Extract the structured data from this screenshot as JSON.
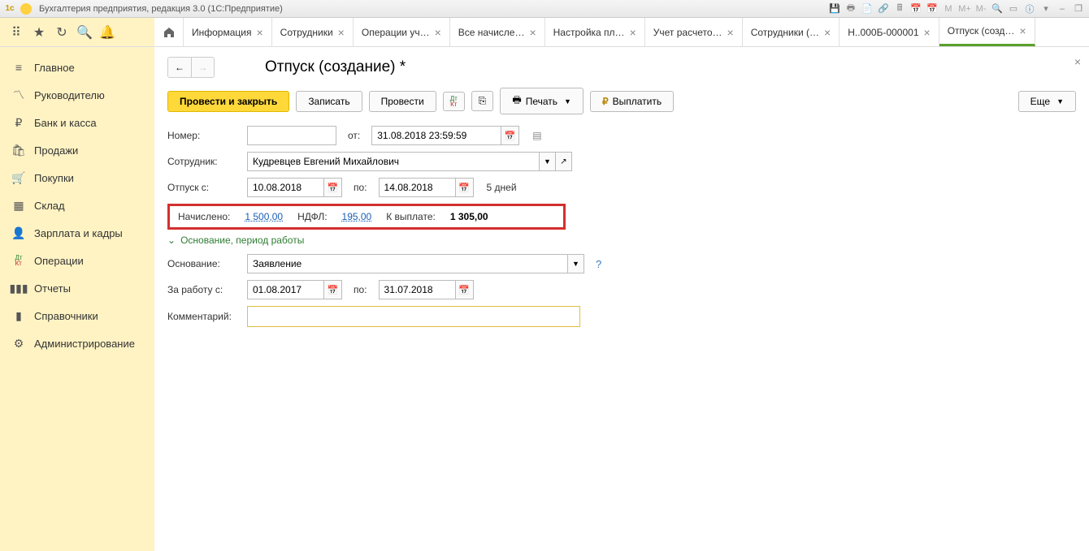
{
  "window": {
    "title": "Бухгалтерия предприятия, редакция 3.0  (1С:Предприятие)"
  },
  "tabs": [
    {
      "label": "Информация"
    },
    {
      "label": "Сотрудники"
    },
    {
      "label": "Операции уч…"
    },
    {
      "label": "Все начисле…"
    },
    {
      "label": "Настройка пл…"
    },
    {
      "label": "Учет расчето…"
    },
    {
      "label": "Сотрудники (…"
    },
    {
      "label": "Н..000Б-000001"
    },
    {
      "label": "Отпуск (созд…",
      "active": true
    }
  ],
  "sidebar": [
    {
      "label": "Главное",
      "icon": "menu"
    },
    {
      "label": "Руководителю",
      "icon": "chart"
    },
    {
      "label": "Банк и касса",
      "icon": "ruble"
    },
    {
      "label": "Продажи",
      "icon": "cart"
    },
    {
      "label": "Покупки",
      "icon": "cart2"
    },
    {
      "label": "Склад",
      "icon": "boxes"
    },
    {
      "label": "Зарплата и кадры",
      "icon": "person"
    },
    {
      "label": "Операции",
      "icon": "dtkt"
    },
    {
      "label": "Отчеты",
      "icon": "bars"
    },
    {
      "label": "Справочники",
      "icon": "book"
    },
    {
      "label": "Администрирование",
      "icon": "gear"
    }
  ],
  "page": {
    "title": "Отпуск (создание) *"
  },
  "buttons": {
    "postClose": "Провести и закрыть",
    "save": "Записать",
    "post": "Провести",
    "print": "Печать",
    "pay": "Выплатить",
    "more": "Еще"
  },
  "form": {
    "numberLabel": "Номер:",
    "number": "",
    "fromLabel": "от:",
    "fromDate": "31.08.2018 23:59:59",
    "employeeLabel": "Сотрудник:",
    "employee": "Кудревцев Евгений Михайлович",
    "vacFromLabel": "Отпуск с:",
    "vacFrom": "10.08.2018",
    "toLabel": "по:",
    "vacTo": "14.08.2018",
    "days": "5 дней",
    "accruedLabel": "Начислено:",
    "accrued": "1 500,00",
    "ndflLabel": "НДФЛ:",
    "ndfl": "195,00",
    "payoutLabel": "К выплате:",
    "payout": "1 305,00",
    "sectionTitle": "Основание, период работы",
    "reasonLabel": "Основание:",
    "reason": "Заявление",
    "workFromLabel": "За работу с:",
    "workFrom": "01.08.2017",
    "workTo": "31.07.2018",
    "commentLabel": "Комментарий:",
    "comment": ""
  }
}
